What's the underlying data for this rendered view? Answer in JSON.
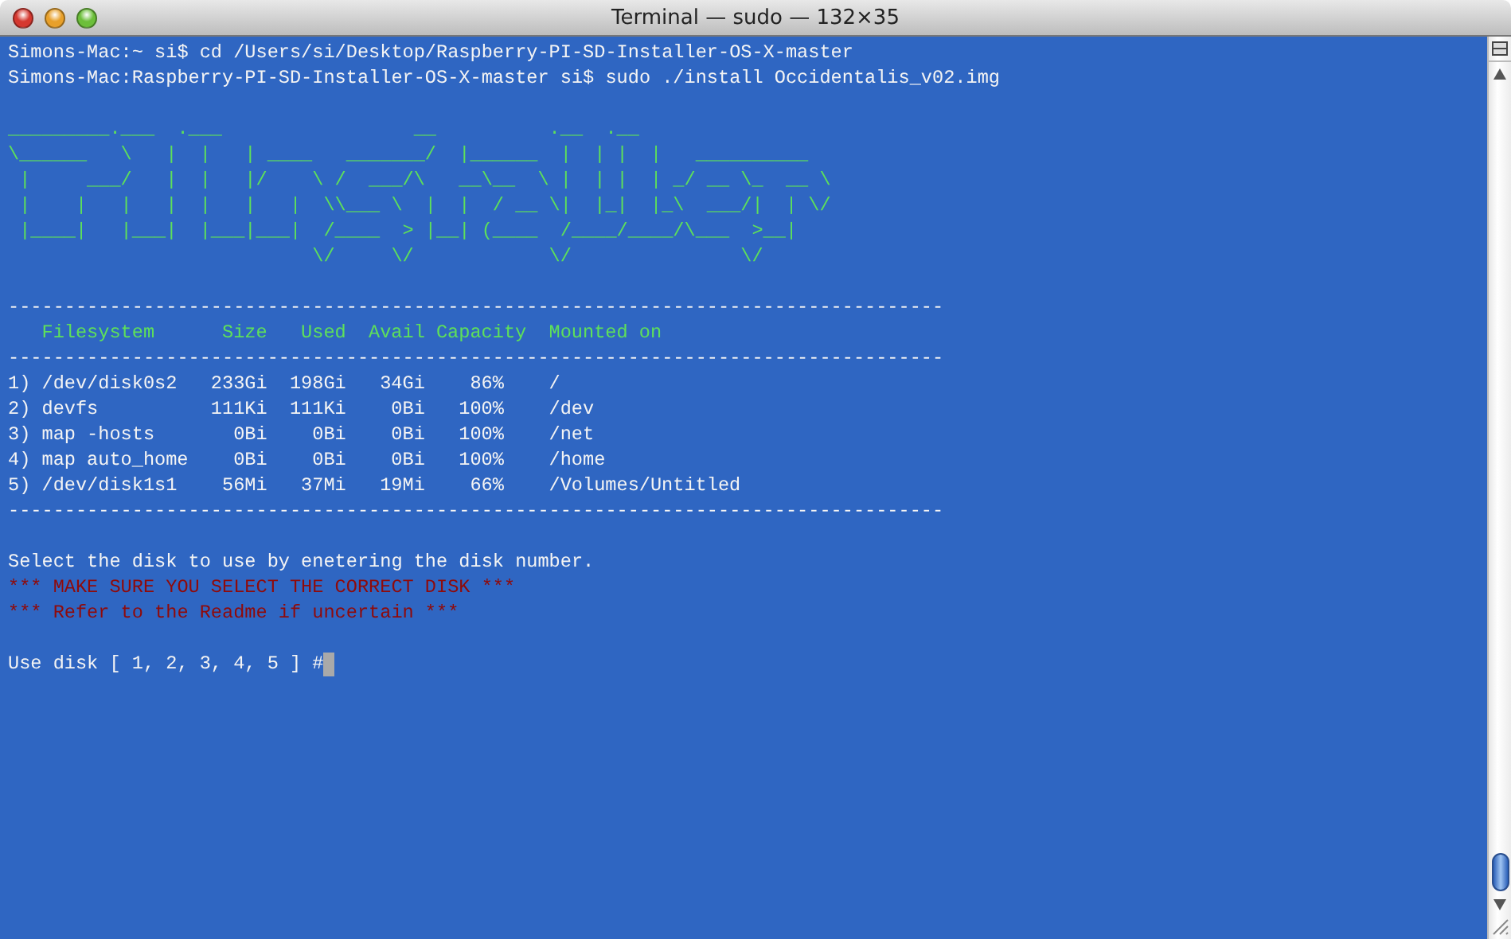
{
  "window": {
    "title": "Terminal — sudo — 132×35"
  },
  "commands": [
    "Simons-Mac:~ si$ cd /Users/si/Desktop/Raspberry-PI-SD-Installer-OS-X-master",
    "Simons-Mac:Raspberry-PI-SD-Installer-OS-X-master si$ sudo ./install Occidentalis_v02.img"
  ],
  "banner": [
    "_________.___  .___                 __          .__  .__",
    "\\______   \\   |  |   | ____   _______/  |______  |  | |  |   __________",
    " |     ___/   |  |   |/    \\ /  ___/\\   __\\__  \\ |  | |  | _/ __ \\_  __ \\",
    " |    |   |   |  |   |   |  \\\\___ \\  |  |  / __ \\|  |_|  |_\\  ___/|  | \\/",
    " |____|   |___|  |___|___|  /____  > |__| (____  /____/____/\\___  >__|",
    "                           \\/     \\/            \\/               \\/"
  ],
  "table": {
    "top_rule": "-----------------------------------------------------------------------------------",
    "columns": [
      "Filesystem",
      "Size",
      "Used",
      "Avail",
      "Capacity",
      "Mounted on"
    ],
    "header_rule": "-----------------------------------------------------------------------------------",
    "rows": [
      {
        "number": "1)",
        "filesystem": "/dev/disk0s2",
        "size": "233Gi",
        "used": "198Gi",
        "avail": "34Gi",
        "capacity": "86%",
        "mounted_on": "/"
      },
      {
        "number": "2)",
        "filesystem": "devfs",
        "size": "111Ki",
        "used": "111Ki",
        "avail": "0Bi",
        "capacity": "100%",
        "mounted_on": "/dev"
      },
      {
        "number": "3)",
        "filesystem": "map -hosts",
        "size": "0Bi",
        "used": "0Bi",
        "avail": "0Bi",
        "capacity": "100%",
        "mounted_on": "/net"
      },
      {
        "number": "4)",
        "filesystem": "map auto_home",
        "size": "0Bi",
        "used": "0Bi",
        "avail": "0Bi",
        "capacity": "100%",
        "mounted_on": "/home"
      },
      {
        "number": "5)",
        "filesystem": "/dev/disk1s1",
        "size": "56Mi",
        "used": "37Mi",
        "avail": "19Mi",
        "capacity": "66%",
        "mounted_on": "/Volumes/Untitled"
      }
    ],
    "bottom_rule": "-----------------------------------------------------------------------------------"
  },
  "messages": [
    {
      "kind": "info",
      "text": "Select the disk to use by enetering the disk number."
    },
    {
      "kind": "warning",
      "text": "*** MAKE SURE YOU SELECT THE CORRECT DISK ***"
    },
    {
      "kind": "warning",
      "text": "*** Refer to the Readme if uncertain ***"
    }
  ],
  "prompt": {
    "text": "Use disk [ 1, 2, 3, 4, 5 ] #"
  }
}
